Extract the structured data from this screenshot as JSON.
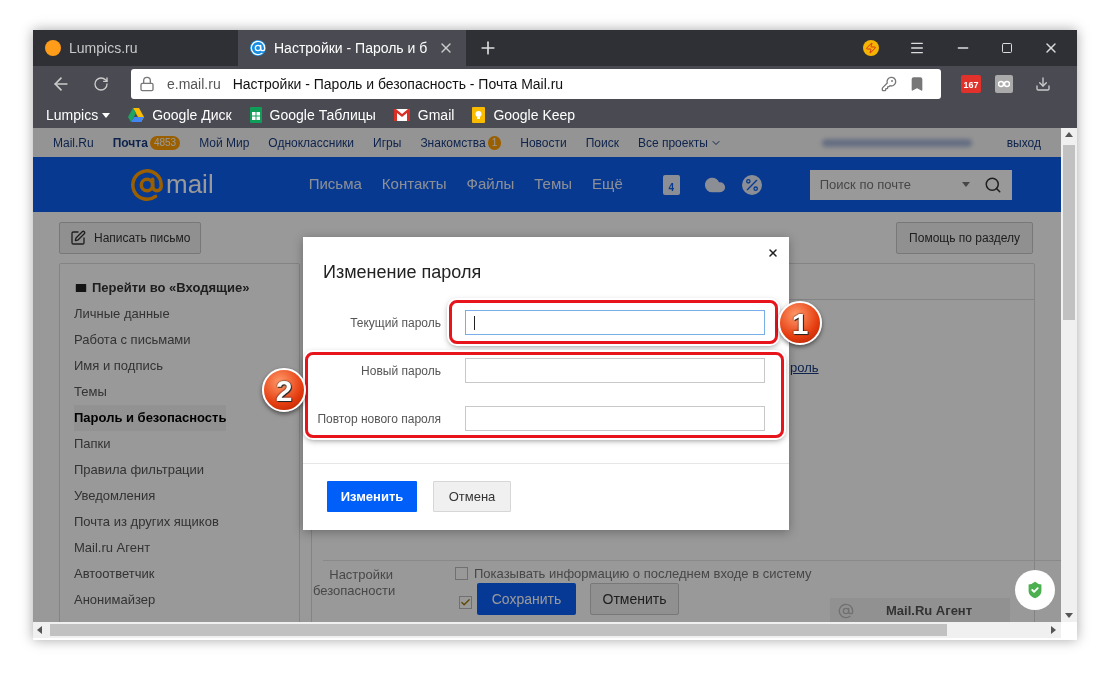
{
  "browser": {
    "tabs": [
      {
        "title": "Lumpics.ru",
        "selected": false
      },
      {
        "title": "Настройки - Пароль и б",
        "selected": true
      }
    ],
    "address": {
      "domain": "e.mail.ru",
      "title": "Настройки - Пароль и безопасность - Почта Mail.ru"
    },
    "extension_badge": "167",
    "bookmarks": [
      {
        "label": "Lumpics",
        "kind": "folder"
      },
      {
        "label": "Google Диск",
        "kind": "drive"
      },
      {
        "label": "Google Таблицы",
        "kind": "sheets"
      },
      {
        "label": "Gmail",
        "kind": "gmail"
      },
      {
        "label": "Google Keep",
        "kind": "keep"
      }
    ]
  },
  "topnav": {
    "items": [
      {
        "label": "Mail.Ru",
        "bold": false
      },
      {
        "label": "Почта",
        "bold": true,
        "counter": "4853"
      },
      {
        "label": "Мой Мир",
        "bold": false
      },
      {
        "label": "Одноклассники",
        "bold": false
      },
      {
        "label": "Игры",
        "bold": false
      },
      {
        "label": "Знакомства",
        "bold": false,
        "counter": "1"
      },
      {
        "label": "Новости",
        "bold": false
      },
      {
        "label": "Поиск",
        "bold": false
      },
      {
        "label": "Все проекты",
        "bold": false,
        "dropdown": true
      }
    ],
    "logout": "выход"
  },
  "header": {
    "logo_text": "mail",
    "nav": [
      "Письма",
      "Контакты",
      "Файлы",
      "Темы",
      "Ещё"
    ],
    "calendar_day": "4",
    "search": {
      "placeholder": "Поиск по почте"
    }
  },
  "compose_button": "Написать письмо",
  "help_button": "Помощь по разделу",
  "sidebar": {
    "items": [
      {
        "label": "Перейти во «Входящие»",
        "kind": "inbox",
        "selected": false
      },
      {
        "label": "Личные данные",
        "kind": "link",
        "selected": false
      },
      {
        "label": "Работа с письмами",
        "kind": "link",
        "selected": false
      },
      {
        "label": "Имя и подпись",
        "kind": "link",
        "selected": false
      },
      {
        "label": "Темы",
        "kind": "link",
        "selected": false
      },
      {
        "label": "Пароль и безопасность",
        "kind": "link",
        "selected": true
      },
      {
        "label": "Папки",
        "kind": "link",
        "selected": false
      },
      {
        "label": "Правила фильтрации",
        "kind": "link",
        "selected": false
      },
      {
        "label": "Уведомления",
        "kind": "link",
        "selected": false
      },
      {
        "label": "Почта из других ящиков",
        "kind": "link",
        "selected": false
      },
      {
        "label": "Mail.ru Агент",
        "kind": "link",
        "selected": false
      },
      {
        "label": "Автоответчик",
        "kind": "link",
        "selected": false
      },
      {
        "label": "Анонимайзер",
        "kind": "link",
        "selected": false
      }
    ]
  },
  "content_link": "роль",
  "footer": {
    "label": "Настройки безопасности",
    "options": [
      {
        "label": "Показывать информацию о последнем входе в систему",
        "checked": false
      },
      {
        "checked": true
      }
    ],
    "buttons": [
      {
        "label": "Сохранить",
        "kind": "primary"
      },
      {
        "label": "Отменить",
        "kind": "secondary"
      }
    ],
    "agent": "Mail.Ru Агент"
  },
  "dialog": {
    "title": "Изменение пароля",
    "fields": [
      {
        "label": "Текущий пароль",
        "focused": true
      },
      {
        "label": "Новый пароль",
        "focused": false
      },
      {
        "label": "Повтор нового пароля",
        "focused": false
      }
    ],
    "buttons": [
      {
        "label": "Изменить",
        "kind": "primary"
      },
      {
        "label": "Отмена",
        "kind": "secondary"
      }
    ]
  },
  "annotations": [
    {
      "number": "1"
    },
    {
      "number": "2"
    }
  ]
}
